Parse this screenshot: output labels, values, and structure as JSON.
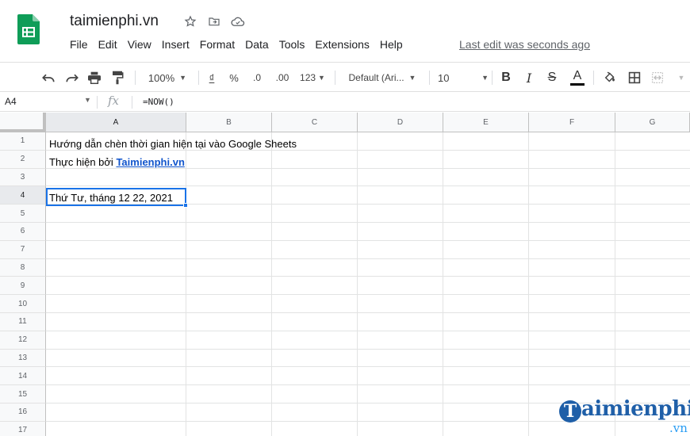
{
  "window": {
    "doc_title": "taimienphi.vn",
    "last_edit": "Last edit was seconds ago"
  },
  "menu": [
    "File",
    "Edit",
    "View",
    "Insert",
    "Format",
    "Data",
    "Tools",
    "Extensions",
    "Help"
  ],
  "toolbar": {
    "zoom": "100%",
    "currency": "₫",
    "percent": "%",
    "dec_decrease": ".0",
    "dec_increase": ".00",
    "more_formats": "123",
    "font_family": "Default (Ari...",
    "font_size": "10",
    "bold": "B",
    "italic": "I",
    "strike": "S",
    "text_color": "A"
  },
  "formula_bar": {
    "cell_ref": "A4",
    "fx": "fx",
    "formula": "=NOW()"
  },
  "columns": [
    "A",
    "B",
    "C",
    "D",
    "E",
    "F",
    "G"
  ],
  "rows": [
    "1",
    "2",
    "3",
    "4",
    "5",
    "6",
    "7",
    "8",
    "9",
    "10",
    "11",
    "12",
    "13",
    "14",
    "15",
    "16",
    "17"
  ],
  "cells": {
    "A1": "Hướng dẫn chèn thời gian hiện tại vào Google Sheets",
    "A2_prefix": "Thực hiện bởi",
    "A2_link": "Taimienphi.vn",
    "A4": "Thứ Tư, tháng 12 22, 2021"
  },
  "selected_cell": "A4",
  "watermark": {
    "initial": "T",
    "text": "aimienphi",
    "suffix": ".vn"
  },
  "colors": {
    "selection": "#1a73e8",
    "link": "#1155cc",
    "sheets_green": "#0f9d58"
  }
}
